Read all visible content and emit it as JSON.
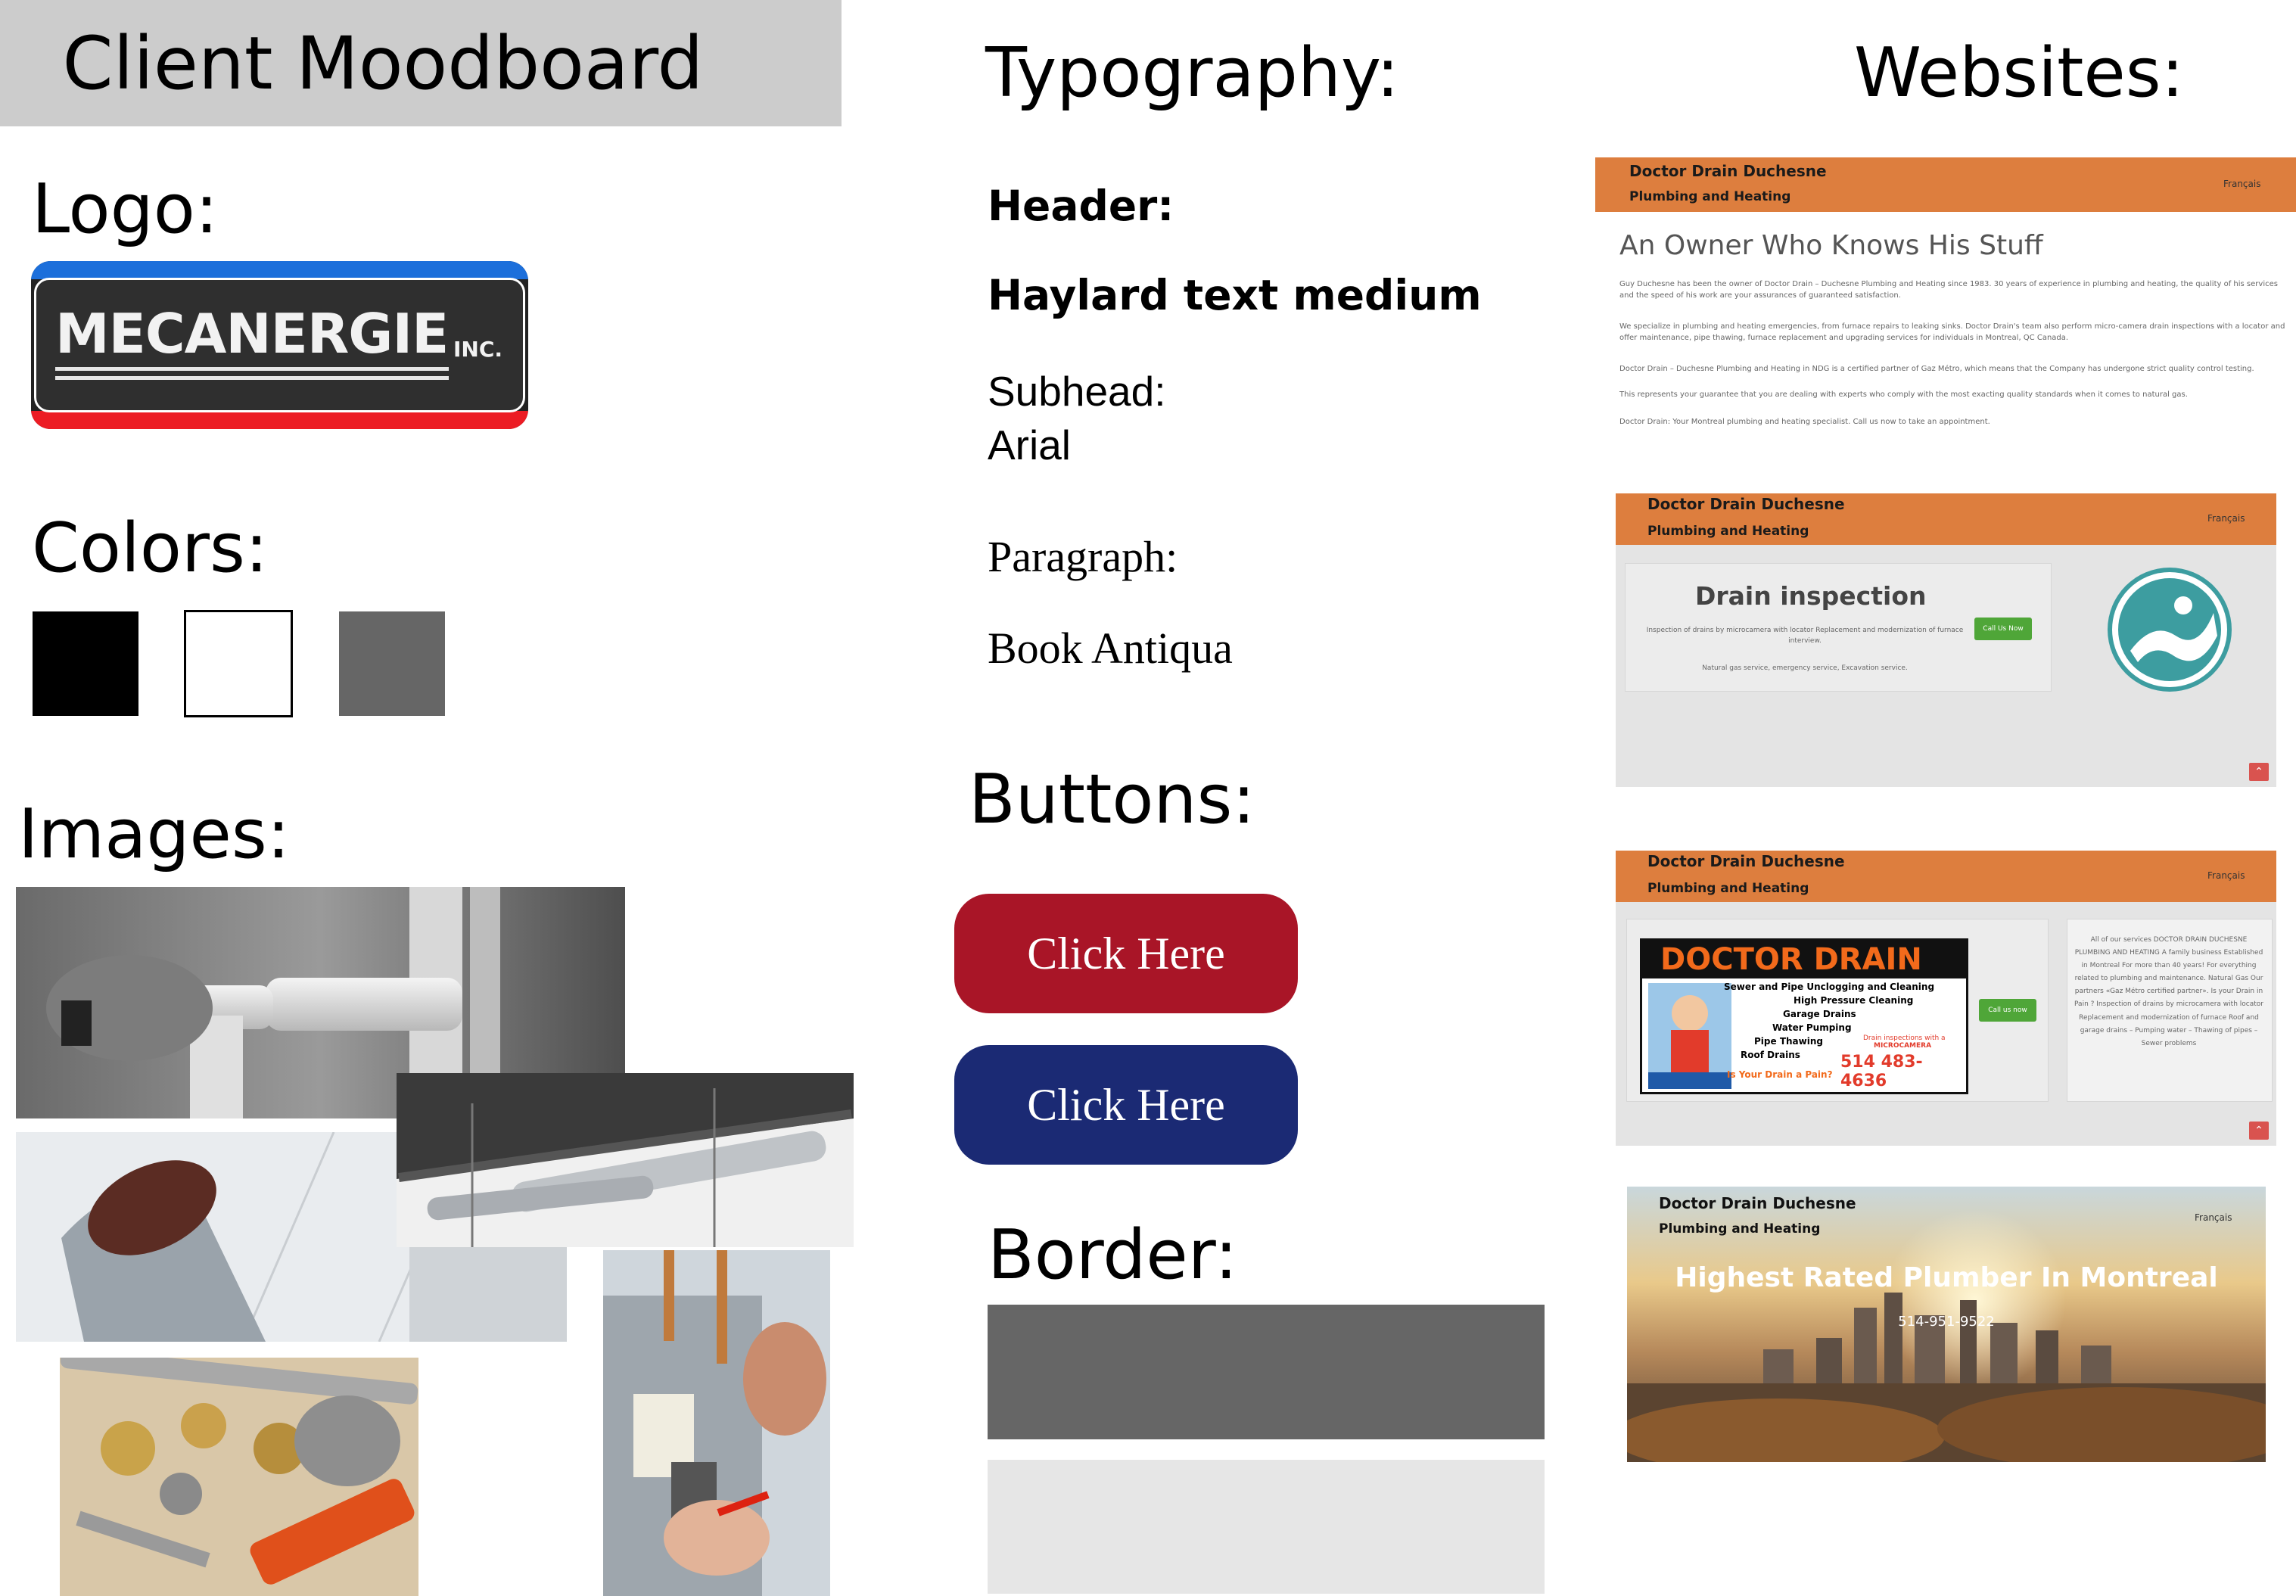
{
  "board": {
    "title": "Client Moodboard"
  },
  "sections": {
    "logo": "Logo:",
    "colors": "Colors:",
    "images": "Images:",
    "typography": "Typography:",
    "buttons": "Buttons:",
    "border": "Border:",
    "websites": "Websites:"
  },
  "logo": {
    "word": "MECANERGIE",
    "suffix": "INC.",
    "colors": {
      "top_stripe": "#1c6fdb",
      "bottom_stripe": "#ec1c24",
      "plate": "#2f2f2f"
    }
  },
  "colors": {
    "swatches": [
      "#000000",
      "#ffffff",
      "#666666"
    ]
  },
  "typography": {
    "header_label": "Header:",
    "header_font": "Haylard text medium",
    "subhead_label": "Subhead:",
    "subhead_font": "Arial",
    "paragraph_label": "Paragraph:",
    "paragraph_font": "Book Antiqua"
  },
  "buttons": {
    "primary": {
      "label": "Click Here",
      "color": "#a91527"
    },
    "secondary": {
      "label": "Click Here",
      "color": "#1b2a74"
    }
  },
  "border": {
    "colors": [
      "#666666",
      "#e6e6e6"
    ]
  },
  "websites": {
    "brand": "Doctor Drain Duchesne",
    "tagline": "Plumbing and Heating",
    "language": "Français",
    "site1": {
      "heading": "An Owner Who Knows His Stuff",
      "paragraphs": [
        "Guy Duchesne has been the owner of Doctor Drain – Duchesne Plumbing and Heating since 1983. 30 years of experience in plumbing and heating, the quality of his services and the speed of his work are your assurances of guaranteed satisfaction.",
        "We specialize in plumbing and heating emergencies, from furnace repairs to leaking sinks. Doctor Drain's team also perform micro-camera drain inspections with a locator and offer maintenance, pipe thawing, furnace replacement and upgrading services for individuals in Montreal, QC Canada.",
        "Doctor Drain – Duchesne Plumbing and Heating in NDG is a certified partner of Gaz Métro, which means that the Company has undergone strict quality control testing.",
        "This represents your guarantee that you are dealing with experts who comply with the most exacting quality standards when it comes to natural gas.",
        "Doctor Drain: Your Montreal plumbing and heating specialist. Call us now to take an appointment."
      ]
    },
    "site2": {
      "heading": "Drain inspection",
      "line1": "Inspection of drains by microcamera with locator Replacement and modernization of furnace interview.",
      "line2": "Natural gas service, emergency service, Excavation service.",
      "cta": "Call Us Now"
    },
    "site3": {
      "ad_title": "DOCTOR DRAIN",
      "ad_services": [
        "Sewer and Pipe Unclogging and Cleaning",
        "High Pressure Cleaning",
        "Garage Drains",
        "Water Pumping",
        "Pipe Thawing",
        "Roof Drains"
      ],
      "ad_camera": "Drain inspections with a",
      "ad_camera2": "MICROCAMERA",
      "ad_phone": "514 483-4636",
      "ad_slogan": "Is Your Drain a Pain?",
      "cta": "Call us now",
      "side_text": "All of our services DOCTOR DRAIN DUCHESNE PLUMBING AND HEATING A family business Established in Montreal For more than 40 years! For everything related to plumbing and maintenance. Natural Gas Our partners «Gaz Métro certified partner». Is your Drain in Pain ? Inspection of drains by microcamera with locator Replacement and modernization of furnace Roof and garage drains – Pumping water – Thawing of pipes – Sewer problems"
    },
    "site4": {
      "heading": "Highest Rated Plumber In Montreal",
      "phone": "514-951-9522"
    }
  }
}
